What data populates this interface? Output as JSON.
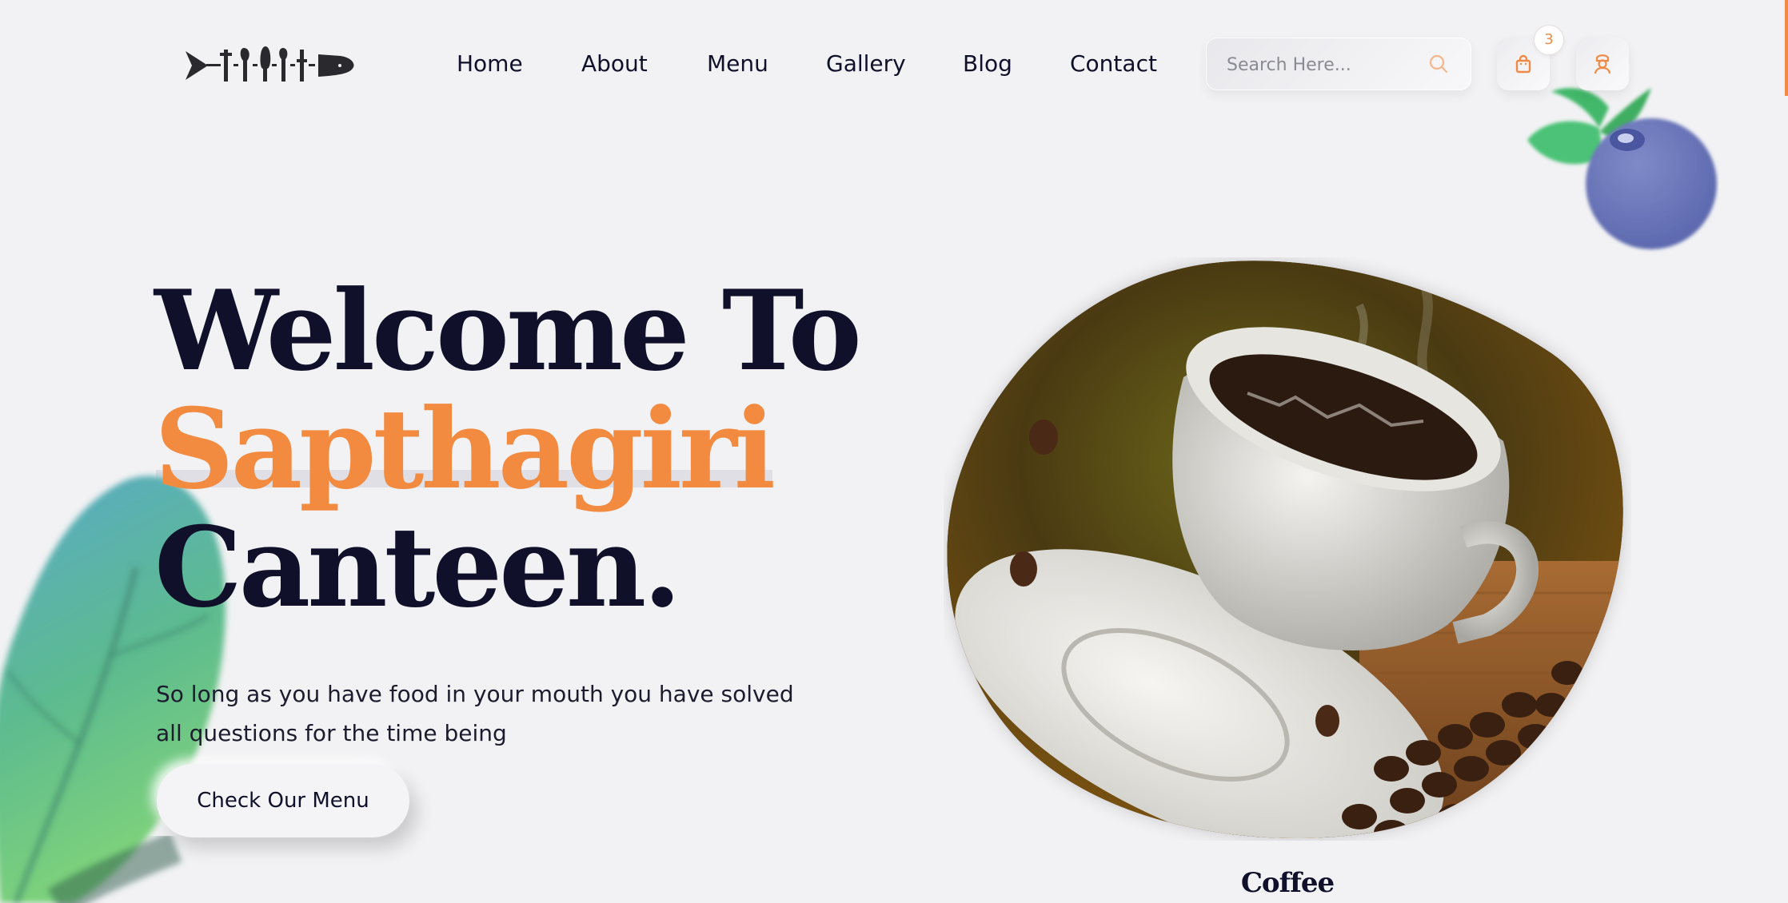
{
  "header": {
    "logo_alt": "canteen cutlery logo",
    "nav": [
      {
        "label": "Home"
      },
      {
        "label": "About"
      },
      {
        "label": "Menu"
      },
      {
        "label": "Gallery"
      },
      {
        "label": "Blog"
      },
      {
        "label": "Contact"
      }
    ],
    "search": {
      "placeholder": "Search Here...",
      "value": ""
    },
    "cart": {
      "count": "3",
      "icon": "shopping-bag-icon"
    },
    "user": {
      "icon": "chef-user-icon"
    }
  },
  "hero": {
    "title_line1": "Welcome To",
    "title_accent": "Sapthagiri",
    "title_line3": "Canteen.",
    "text": "So long as you have food in your mouth you have solved all questions for the time being",
    "cta_label": "Check Our Menu",
    "image_caption": "Coffee"
  },
  "colors": {
    "accent": "#f28a3f",
    "dark": "#10102a",
    "background": "#f2f2f4",
    "blueberry": "#6a76b8",
    "leaf_green": "#4cba6e"
  }
}
